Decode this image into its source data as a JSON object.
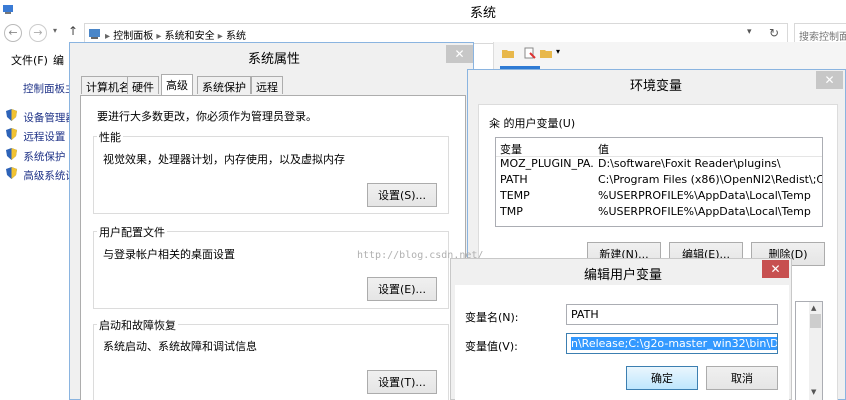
{
  "explorer": {
    "title": "系统",
    "menu": [
      "文件(F)",
      "编"
    ],
    "breadcrumb": [
      "控制面板",
      "系统和安全",
      "系统"
    ],
    "search_placeholder": "搜索控制面",
    "sidebar": {
      "header": "控制面板主",
      "items": [
        "设备管理器",
        "远程设置",
        "系统保护",
        "高级系统设"
      ]
    }
  },
  "sysprops": {
    "title": "系统属性",
    "tabs": [
      "计算机名",
      "硬件",
      "高级",
      "系统保护",
      "远程"
    ],
    "admin_note": "要进行大多数更改，你必须作为管理员登录。",
    "groups": [
      {
        "label": "性能",
        "desc": "视觉效果，处理器计划，内存使用，以及虚拟内存",
        "button": "设置(S)..."
      },
      {
        "label": "用户配置文件",
        "desc": "与登录帐户相关的桌面设置",
        "button": "设置(E)..."
      },
      {
        "label": "启动和故障恢复",
        "desc": "系统启动、系统故障和调试信息",
        "button": "设置(T)..."
      }
    ]
  },
  "envvars": {
    "title": "环境变量",
    "user_label": "籴 的用户变量(U)",
    "columns": [
      "变量",
      "值"
    ],
    "rows": [
      {
        "name": "MOZ_PLUGIN_PA...",
        "value": "D:\\software\\Foxit Reader\\plugins\\"
      },
      {
        "name": "PATH",
        "value": "C:\\Program Files (x86)\\OpenNI2\\Redist\\;C..."
      },
      {
        "name": "TEMP",
        "value": "%USERPROFILE%\\AppData\\Local\\Temp"
      },
      {
        "name": "TMP",
        "value": "%USERPROFILE%\\AppData\\Local\\Temp"
      }
    ],
    "buttons": [
      "新建(N)...",
      "编辑(E)...",
      "删除(D)"
    ]
  },
  "edituser": {
    "title": "编辑用户变量",
    "name_label": "变量名(N):",
    "value_label": "变量值(V):",
    "name_value": "PATH",
    "value_value": "n\\Release;C:\\g2o-master_win32\\bin\\Debug;",
    "ok": "确定",
    "cancel": "取消"
  },
  "watermark": "http://blog.csdn.net/"
}
